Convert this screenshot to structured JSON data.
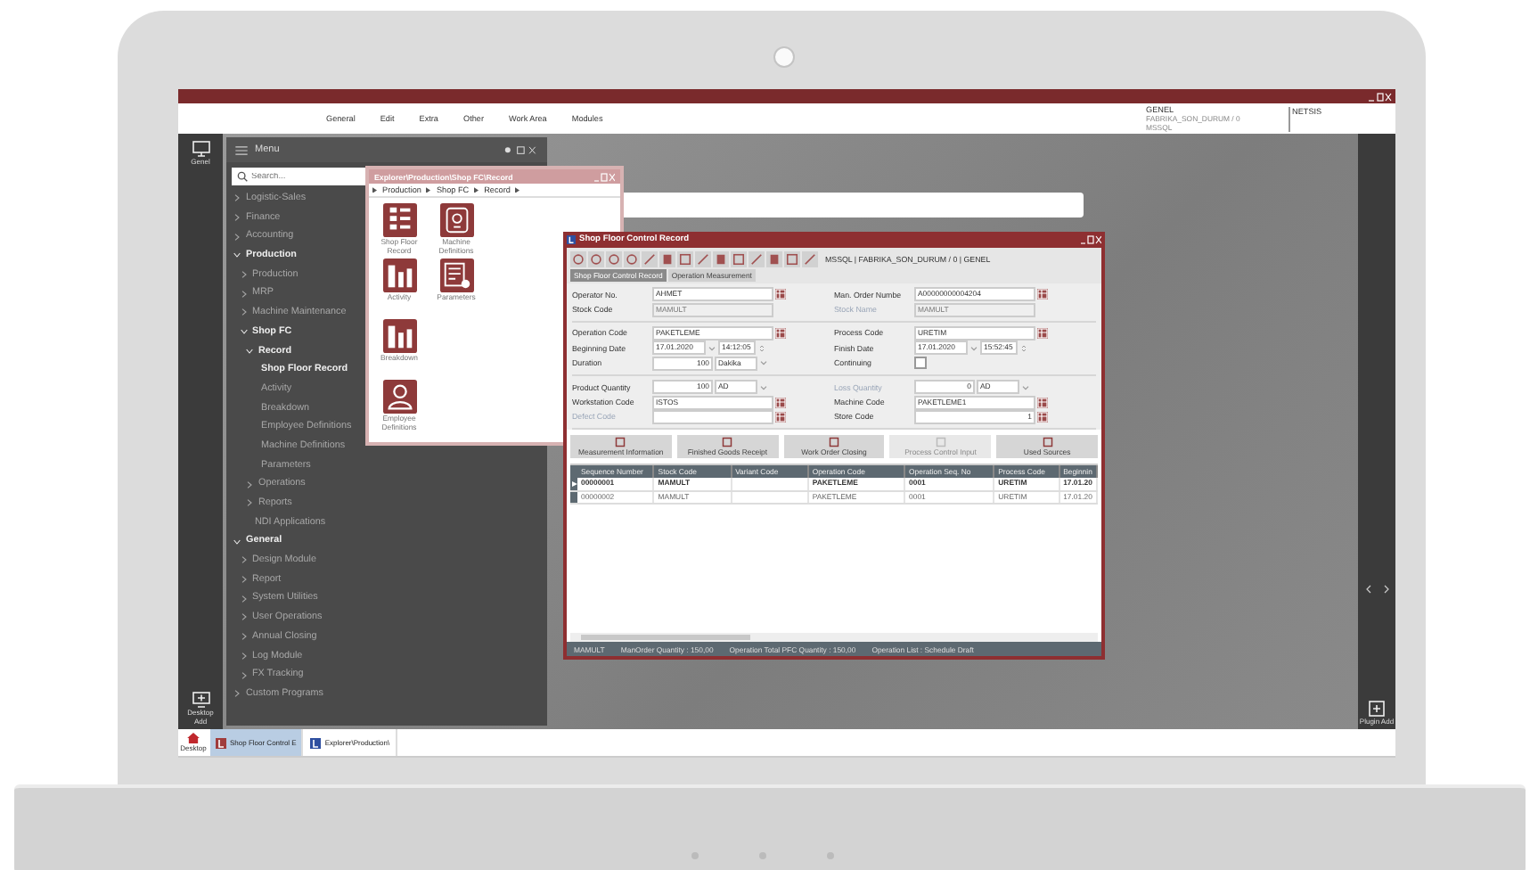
{
  "menubar": [
    "General",
    "Edit",
    "Extra",
    "Other",
    "Work Area",
    "Modules"
  ],
  "company": {
    "name": "GENEL",
    "database": "FABRIKA_SON_DURUM / 0",
    "server": "MSSQL"
  },
  "user": "NETSIS",
  "left_rail": {
    "top": "Genel",
    "bottom": "Desktop Add"
  },
  "right_rail": {
    "button": "Plugin Add"
  },
  "menu_panel": {
    "title": "Menu",
    "search": {
      "placeholder": "Search..."
    },
    "items": [
      {
        "label": "Logistic-Sales",
        "kind": "folder",
        "expanded": false
      },
      {
        "label": "Finance",
        "kind": "folder",
        "expanded": false
      },
      {
        "label": "Accounting",
        "kind": "folder",
        "expanded": false
      },
      {
        "label": "Production",
        "kind": "folder",
        "expanded": true,
        "children": [
          {
            "label": "Production",
            "kind": "folder",
            "expanded": false
          },
          {
            "label": "MRP",
            "kind": "folder",
            "expanded": false
          },
          {
            "label": "Machine Maintenance",
            "kind": "folder",
            "expanded": false
          },
          {
            "label": "Shop FC",
            "kind": "folder",
            "expanded": true,
            "children": [
              {
                "label": "Record",
                "kind": "folder",
                "expanded": true,
                "children": [
                  {
                    "label": "Shop Floor Record",
                    "kind": "leaf",
                    "selected": true
                  },
                  {
                    "label": "Activity",
                    "kind": "leaf",
                    "selected": false
                  },
                  {
                    "label": "Breakdown",
                    "kind": "leaf",
                    "selected": false
                  },
                  {
                    "label": "Employee Definitions",
                    "kind": "leaf",
                    "selected": false
                  },
                  {
                    "label": "Machine Definitions",
                    "kind": "leaf",
                    "selected": false
                  },
                  {
                    "label": "Parameters",
                    "kind": "leaf",
                    "selected": false
                  }
                ]
              },
              {
                "label": "Operations",
                "kind": "folder",
                "expanded": false
              },
              {
                "label": "Reports",
                "kind": "folder",
                "expanded": false
              },
              {
                "label": "NDI Applications",
                "kind": "leaf",
                "selected": false
              }
            ]
          }
        ]
      },
      {
        "label": "General",
        "kind": "folder",
        "expanded": true,
        "children": [
          {
            "label": "Design Module",
            "kind": "folder",
            "expanded": false
          },
          {
            "label": "Report",
            "kind": "folder",
            "expanded": false
          },
          {
            "label": "System Utilities",
            "kind": "folder",
            "expanded": false
          },
          {
            "label": "User Operations",
            "kind": "folder",
            "expanded": false
          },
          {
            "label": "Annual Closing",
            "kind": "folder",
            "expanded": false
          },
          {
            "label": "Log Module",
            "kind": "folder",
            "expanded": false
          },
          {
            "label": "FX Tracking",
            "kind": "folder",
            "expanded": false
          }
        ]
      },
      {
        "label": "Custom Programs",
        "kind": "folder",
        "expanded": false
      }
    ]
  },
  "explorer": {
    "title": "Explorer\\Production\\Shop FC\\Record",
    "breadcrumb": [
      "Production",
      "Shop FC",
      "Record"
    ],
    "items": [
      {
        "label": "Shop Floor Record",
        "kind": "list"
      },
      {
        "label": "Machine Definitions",
        "kind": "machine"
      },
      {
        "label": "Activity",
        "kind": "bars"
      },
      {
        "label": "Parameters",
        "kind": "settings"
      },
      {
        "label": "Breakdown",
        "kind": "bars"
      },
      {
        "label": "Employee Definitions",
        "kind": "person"
      }
    ]
  },
  "record_window": {
    "title": "Shop Floor Control Record",
    "connection": "MSSQL | FABRIKA_SON_DURUM / 0 | GENEL",
    "tabs": [
      {
        "label": "Shop Floor Control Record",
        "selected": true
      },
      {
        "label": "Operation Measurement",
        "selected": false
      }
    ],
    "sections": [
      [
        [
          {
            "label": "Operator No.",
            "kind": "lookup",
            "value": "AHMET",
            "disabled": false
          },
          {
            "label": "Man. Order Numbe",
            "kind": "lookup",
            "value": "A00000000004204",
            "disabled": false
          }
        ],
        [
          {
            "label": "Stock Code",
            "kind": "text",
            "value": "MAMULT",
            "disabled": false
          },
          {
            "label": "Stock Name",
            "kind": "text",
            "value": "MAMULT",
            "disabled": true
          }
        ]
      ],
      [
        [
          {
            "label": "Operation Code",
            "kind": "lookup",
            "value": "PAKETLEME",
            "disabled": false
          },
          {
            "label": "Process Code",
            "kind": "lookup",
            "value": "URETIM",
            "disabled": false
          }
        ],
        [
          {
            "label": "Beginning Date",
            "kind": "datetime",
            "value": "17.01.2020",
            "time": "14:12:05",
            "disabled": false
          },
          {
            "label": "Finish Date",
            "kind": "datetime",
            "value": "17.01.2020",
            "time": "15:52:45",
            "disabled": false
          }
        ],
        [
          {
            "label": "Duration",
            "kind": "unit",
            "value": "100",
            "unit": "Dakika",
            "disabled": false
          },
          {
            "label": "Continuing",
            "kind": "checkbox",
            "checked": false,
            "disabled": false
          }
        ]
      ],
      [
        [
          {
            "label": "Product Quantity",
            "kind": "unit",
            "value": "100",
            "unit": "AD",
            "disabled": false
          },
          {
            "label": "Loss Quantity",
            "kind": "unit",
            "value": "0",
            "unit": "AD",
            "disabled": true
          }
        ],
        [
          {
            "label": "Workstation Code",
            "kind": "lookup",
            "value": "ISTOS",
            "disabled": false
          },
          {
            "label": "Machine Code",
            "kind": "lookup",
            "value": "PAKETLEME1",
            "disabled": false
          }
        ],
        [
          {
            "label": "Defect Code",
            "kind": "lookup",
            "disabled": true
          },
          {
            "label": "Store Code",
            "kind": "lookup",
            "value": "1",
            "disabled": false
          }
        ]
      ]
    ],
    "actions": [
      {
        "label": "Measurement Information",
        "disabled": false
      },
      {
        "label": "Finished Goods Receipt",
        "disabled": false
      },
      {
        "label": "Work Order Closing",
        "disabled": false
      },
      {
        "label": "Process Control Input",
        "disabled": true
      },
      {
        "label": "Used Sources",
        "disabled": false
      }
    ],
    "table": {
      "columns": [
        "Sequence Number",
        "Stock Code",
        "Variant Code",
        "Operation Code",
        "Operation Seq. No",
        "Process Code",
        "Beginnin"
      ],
      "rows": [
        {
          "selected": true,
          "cells": [
            "00000001",
            "MAMULT",
            "",
            "PAKETLEME",
            "0001",
            "URETIM",
            "17.01.20"
          ]
        },
        {
          "selected": false,
          "cells": [
            "00000002",
            "MAMULT",
            "",
            "PAKETLEME",
            "0001",
            "URETIM",
            "17.01.20"
          ]
        }
      ]
    },
    "status": [
      "MAMULT",
      "ManOrder Quantity : 150,00",
      "Operation Total PFC Quantity : 150,00",
      "Operation List : Schedule Draft"
    ]
  },
  "taskbar": {
    "home": "Desktop",
    "tabs": [
      {
        "label": "Shop Floor Control E",
        "selected": true
      },
      {
        "label": "Explorer\\Production\\",
        "selected": false
      }
    ]
  }
}
